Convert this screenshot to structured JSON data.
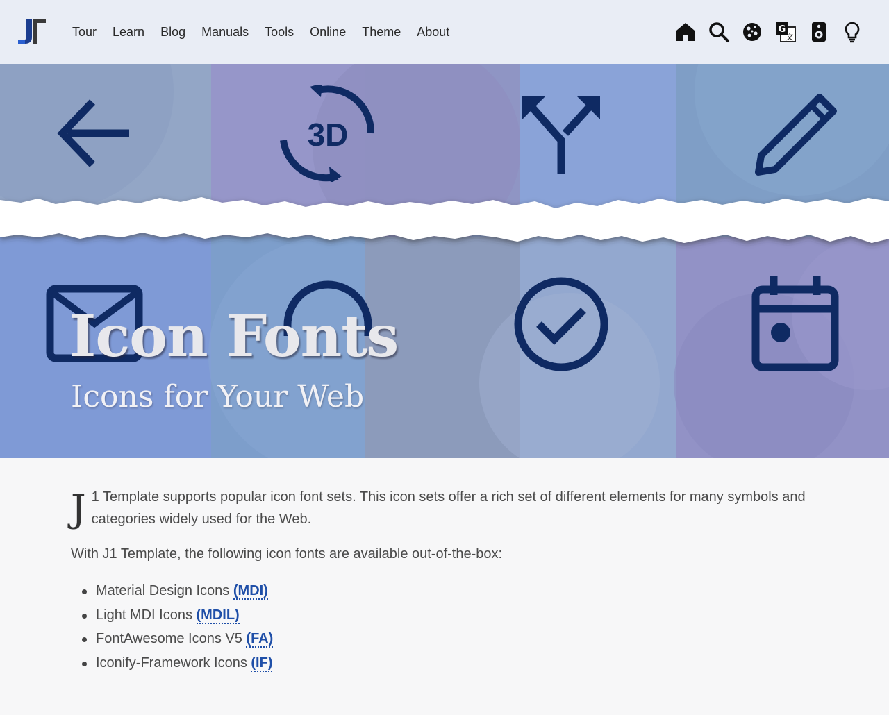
{
  "header": {
    "logo_alt": "J1",
    "nav": [
      "Tour",
      "Learn",
      "Blog",
      "Manuals",
      "Tools",
      "Online",
      "Theme",
      "About"
    ],
    "tools": [
      "home-icon",
      "search-icon",
      "cookie-icon",
      "translate-icon",
      "speaker-icon",
      "lightbulb-icon"
    ]
  },
  "hero": {
    "title": "Icon Fonts",
    "subtitle": "Icons for Your Web",
    "icons": [
      "arrow-left-icon",
      "rotate-3d-icon",
      "call-split-icon",
      "pencil-icon",
      "email-icon",
      "headphones-icon",
      "check-circle-icon",
      "calendar-icon"
    ]
  },
  "content": {
    "dropcap": "J",
    "intro": "1 Template supports popular icon font sets. This icon sets offer a rich set of different elements for many symbols and categories widely used for the Web.",
    "para2": "With J1 Template, the following icon fonts are available out-of-the-box:",
    "list": [
      {
        "label": "Material Design Icons ",
        "abbr": "(MDI)"
      },
      {
        "label": "Light MDI Icons ",
        "abbr": "(MDIL)"
      },
      {
        "label": "FontAwesome Icons V5 ",
        "abbr": "(FA)"
      },
      {
        "label": "Iconify-Framework Icons ",
        "abbr": "(IF)"
      }
    ]
  },
  "colors": {
    "icon_dark": "#0f2a63",
    "link": "#1f4fa8",
    "header_bg": "#e9edf5"
  }
}
